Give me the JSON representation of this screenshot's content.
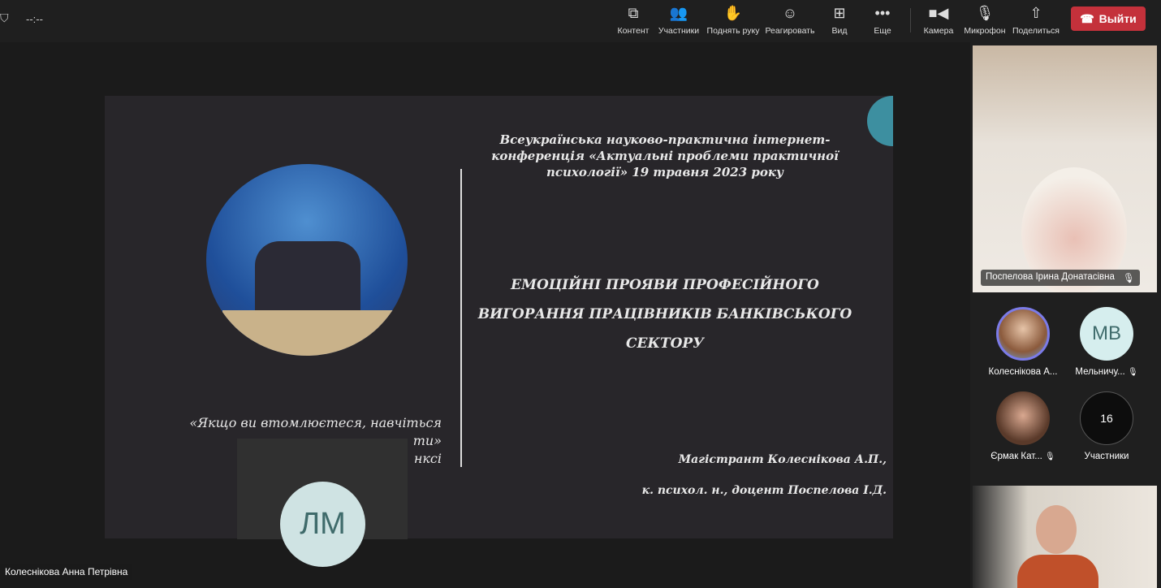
{
  "topbar": {
    "timer": "--:--",
    "buttons": [
      {
        "icon": "content-icon",
        "label": "Контент"
      },
      {
        "icon": "participants-icon",
        "label": "Участники"
      },
      {
        "icon": "raise-hand-icon",
        "label": "Поднять руку"
      },
      {
        "icon": "react-icon",
        "label": "Реагировать"
      },
      {
        "icon": "view-icon",
        "label": "Вид"
      },
      {
        "icon": "more-icon",
        "label": "Еще"
      },
      {
        "icon": "camera-icon",
        "label": "Камера"
      },
      {
        "icon": "mic-off-icon",
        "label": "Микрофон"
      },
      {
        "icon": "share-icon",
        "label": "Поделиться"
      }
    ],
    "leave": "Выйти",
    "leave_color": "#c4313b"
  },
  "slide": {
    "conference": "Всеукраїнська науково-практична інтернет-конференція «Актуальні проблеми практичної психології» 19 травня 2023 року",
    "title": "ЕМОЦІЙНІ ПРОЯВИ ПРОФЕСІЙНОГО ВИГОРАННЯ ПРАЦІВНИКІВ БАНКІВСЬКОГО СЕКТОРУ",
    "quote_line1": "«Якщо ви втомлюєтеся, навчіться",
    "quote_line2": "ти»",
    "quote_line3": "нксі",
    "author1": "Магістрант Колеснікова А.П.,",
    "author2": "к. психол. н., доцент Поспелова І.Д."
  },
  "overlay_participant": {
    "initials": "ЛМ"
  },
  "stage_name": "Колеснікова Анна Петрівна",
  "right_panel": {
    "main_video": "Поспелова Ірина Донатасівна",
    "tiles": [
      {
        "name": "Колеснікова А...",
        "initials": ""
      },
      {
        "name": "Мельничу...",
        "initials": "МВ"
      },
      {
        "name": "Єрмак Кат...",
        "initials": ""
      },
      {
        "name": "Участники",
        "initials": "16"
      }
    ]
  }
}
